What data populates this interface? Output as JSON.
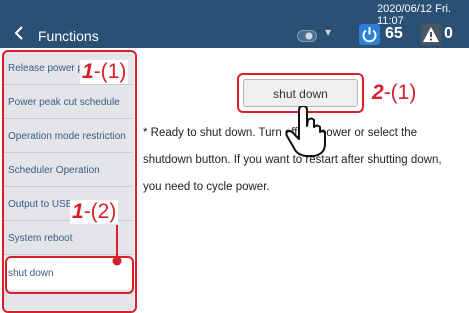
{
  "header": {
    "title": "Functions",
    "datetime": "2020/06/12 Fri. 11:07",
    "power_count": "65",
    "alarm_count": "0"
  },
  "sidebar": {
    "items": [
      {
        "label": "Release power peak cut"
      },
      {
        "label": "Power peak cut schedule"
      },
      {
        "label": "Operation mode restriction"
      },
      {
        "label": "Scheduler Operation"
      },
      {
        "label": "Output to USB memory"
      },
      {
        "label": "System reboot"
      },
      {
        "label": "shut down"
      }
    ]
  },
  "main": {
    "shutdown_button_label": "shut down",
    "message_lines": [
      "* Ready to shut down. Turn off the power or select the",
      "shutdown button. If you want to restart after shutting down,",
      "you need to cycle power."
    ]
  },
  "callouts": {
    "c1_num": "1",
    "c1_sub": "-(1)",
    "c2_num": "1",
    "c2_sub": "-(2)",
    "c3_num": "2",
    "c3_sub": "-(1)"
  },
  "colors": {
    "header_bg": "#2a5073",
    "callout": "#d8202b",
    "power_badge": "#2e7dd7",
    "sidebar_text": "#3a5a87"
  },
  "icons": [
    "back-chevron-icon",
    "network-icon",
    "power-icon",
    "alarm-icon",
    "hand-pointer-icon"
  ]
}
